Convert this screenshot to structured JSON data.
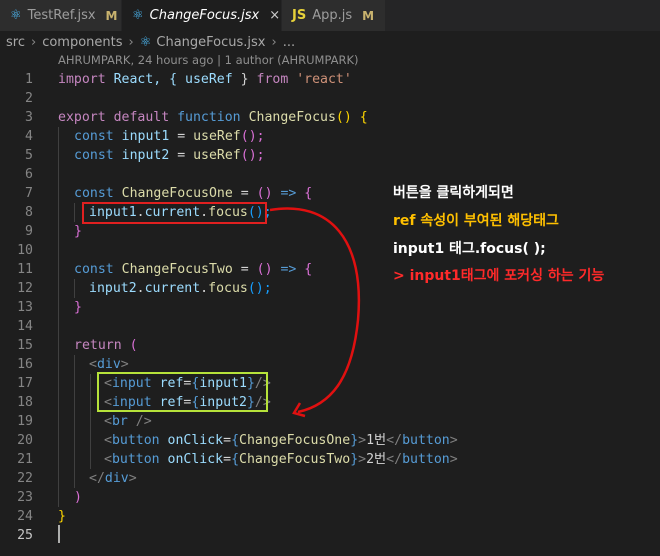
{
  "tabs": [
    {
      "label": "TestRef.jsx",
      "badge": "M",
      "icon": "react-icon"
    },
    {
      "label": "ChangeFocus.jsx",
      "close": "×",
      "icon": "react-icon"
    },
    {
      "label": "App.js",
      "badge": "M",
      "icon": "js-icon",
      "icon_text": "JS"
    }
  ],
  "breadcrumb": {
    "items": [
      "src",
      "components",
      "ChangeFocus.jsx",
      "..."
    ]
  },
  "blame": "AHRUMPARK, 24 hours ago | 1 author (AHRUMPARK)",
  "line_numbers": [
    "1",
    "2",
    "3",
    "4",
    "5",
    "6",
    "7",
    "8",
    "9",
    "10",
    "11",
    "12",
    "13",
    "14",
    "15",
    "16",
    "17",
    "18",
    "19",
    "20",
    "21",
    "22",
    "23",
    "24",
    "25"
  ],
  "code": {
    "l1": {
      "a": "import",
      "b": " React, { ",
      "c": "useRef",
      "d": " } ",
      "e": "from",
      "f": " 'react'"
    },
    "l3": {
      "a": "export",
      "b": " default ",
      "c": "function",
      "d": " ChangeFocus",
      "e": "() {"
    },
    "l4": {
      "a": "const",
      "b": " input1",
      "c": " = ",
      "d": "useRef",
      "e": "();"
    },
    "l5": {
      "a": "const",
      "b": " input2",
      "c": " = ",
      "d": "useRef",
      "e": "();"
    },
    "l7": {
      "a": "const",
      "b": " ChangeFocusOne",
      "c": " = ",
      "d": "() ",
      "e": "=>",
      "f": " {"
    },
    "l8": {
      "a": "input1",
      "b": ".",
      "c": "current",
      "d": ".",
      "e": "focus",
      "f": "();"
    },
    "l9": {
      "a": "}"
    },
    "l11": {
      "a": "const",
      "b": " ChangeFocusTwo",
      "c": " = ",
      "d": "() ",
      "e": "=>",
      "f": " {"
    },
    "l12": {
      "a": "input2",
      "b": ".",
      "c": "current",
      "d": ".",
      "e": "focus",
      "f": "();"
    },
    "l13": {
      "a": "}"
    },
    "l15": {
      "a": "return",
      "b": " ("
    },
    "l16": {
      "a": "<",
      "b": "div",
      "c": ">"
    },
    "l17": {
      "a": "<",
      "b": "input",
      "c": " ref",
      "d": "=",
      "e": "{",
      "f": "input1",
      "g": "}",
      "h": "/>"
    },
    "l18": {
      "a": "<",
      "b": "input",
      "c": " ref",
      "d": "=",
      "e": "{",
      "f": "input2",
      "g": "}",
      "h": "/>"
    },
    "l19": {
      "a": "<",
      "b": "br",
      "c": " />"
    },
    "l20": {
      "a": "<",
      "b": "button",
      "c": " onClick",
      "d": "=",
      "e": "{",
      "f": "ChangeFocusOne",
      "g": "}",
      "h": ">",
      "i": "1번",
      "j": "</",
      "k": "button",
      "l": ">"
    },
    "l21": {
      "a": "<",
      "b": "button",
      "c": " onClick",
      "d": "=",
      "e": "{",
      "f": "ChangeFocusTwo",
      "g": "}",
      "h": ">",
      "i": "2번",
      "j": "</",
      "k": "button",
      "l": ">"
    },
    "l22": {
      "a": "</",
      "b": "div",
      "c": ">"
    },
    "l23": {
      "a": ")"
    },
    "l24": {
      "a": "}"
    }
  },
  "annotations": [
    {
      "text": "버튼을 클릭하게되면",
      "color": "#ffffff"
    },
    {
      "text": "ref 속성이 부여된 해당태그",
      "color": "#ffc000"
    },
    {
      "text": "input1 태그.focus( );",
      "color": "#ffffff"
    },
    {
      "text": "> input1태그에 포커싱 하는 기능",
      "color": "#ff2a2a"
    }
  ],
  "colors": {
    "red_box": "#e02020",
    "green_box": "#b6e23a",
    "arrow": "#e01010"
  }
}
